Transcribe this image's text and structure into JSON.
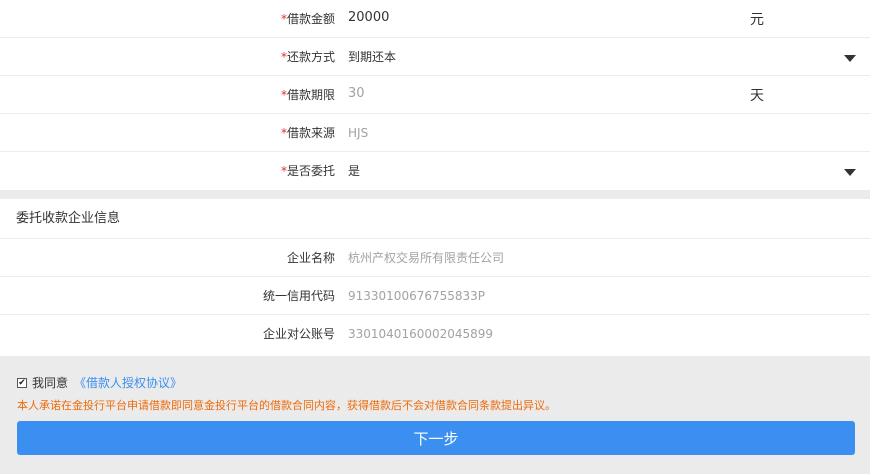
{
  "required_mark": "*",
  "loan_form": {
    "amount": {
      "label": "借款金额",
      "value": "20000",
      "unit": "元"
    },
    "repayment": {
      "label": "还款方式",
      "value": "到期还本"
    },
    "term": {
      "label": "借款期限",
      "value": "30",
      "unit": "天"
    },
    "source": {
      "label": "借款来源",
      "value": "HJS"
    },
    "entrusted": {
      "label": "是否委托",
      "value": "是"
    }
  },
  "company_section": {
    "title": "委托收款企业信息",
    "name": {
      "label": "企业名称",
      "value": "杭州产权交易所有限责任公司"
    },
    "credit_code": {
      "label": "统一信用代码",
      "value": "91330100676755833P"
    },
    "account": {
      "label": "企业对公账号",
      "value": "3301040160002045899"
    }
  },
  "agreement": {
    "checked": true,
    "check_mark": "✔",
    "agree_text": "我同意",
    "link_text": "《借款人授权协议》",
    "notice": "本人承诺在金投行平台申请借款即同意金投行平台的借款合同内容，获得借款后不会对借款合同条款提出异议。"
  },
  "next_button": {
    "label": "下一步"
  },
  "colors": {
    "accent": "#3b8ff0",
    "required": "#e0302b",
    "notice": "#ee6b0a",
    "muted_text": "#a2a2a2",
    "panel_gray": "#ebebeb"
  }
}
